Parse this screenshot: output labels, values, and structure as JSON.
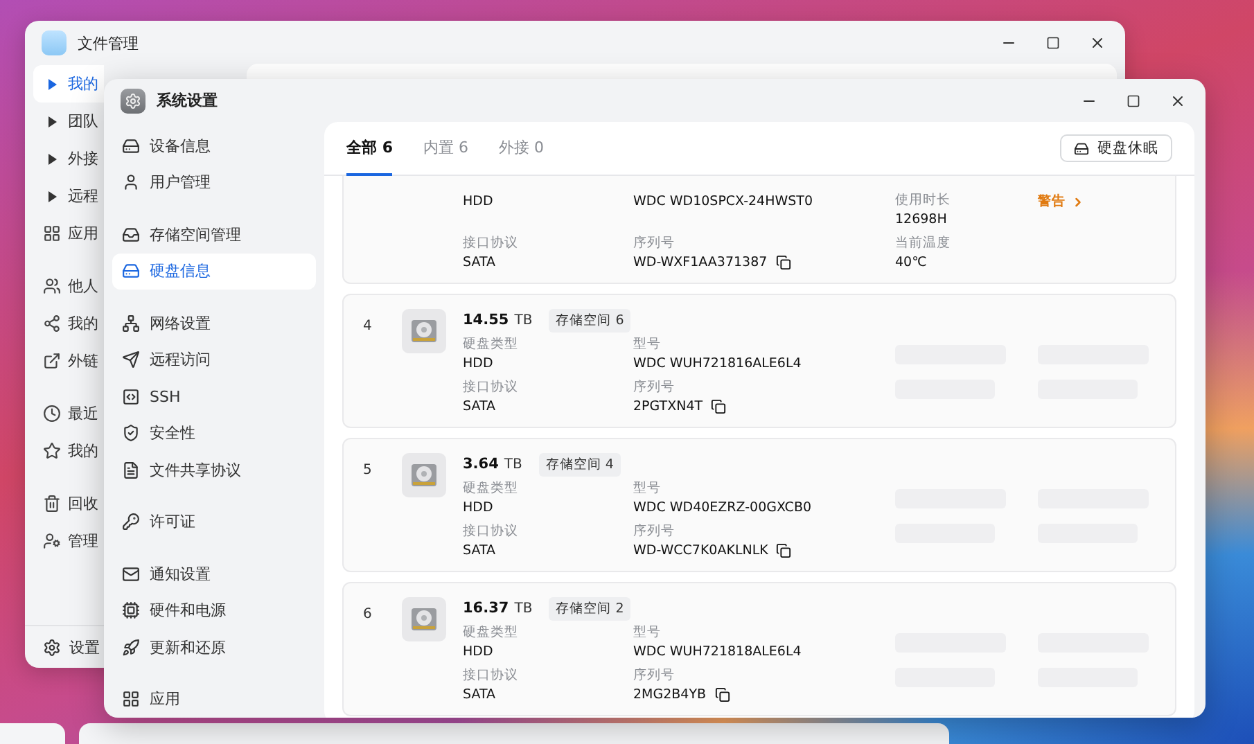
{
  "back_window": {
    "title": "文件管理",
    "sidebar": [
      [
        {
          "label": "我的",
          "kind": "folder",
          "selected": true
        },
        {
          "label": "团队",
          "kind": "folder",
          "selected": false
        },
        {
          "label": "外接",
          "kind": "folder",
          "selected": false
        },
        {
          "label": "远程",
          "kind": "folder",
          "selected": false
        },
        {
          "label": "应用",
          "kind": "item",
          "selected": false
        }
      ],
      [
        {
          "label": "他人",
          "kind": "item",
          "selected": false
        },
        {
          "label": "我的",
          "kind": "item",
          "selected": false
        },
        {
          "label": "外链",
          "kind": "item",
          "selected": false
        }
      ],
      [
        {
          "label": "最近",
          "kind": "item",
          "selected": false
        },
        {
          "label": "我的",
          "kind": "item",
          "selected": false
        }
      ],
      [
        {
          "label": "回收",
          "kind": "item",
          "selected": false
        },
        {
          "label": "管理",
          "kind": "item",
          "selected": false
        }
      ]
    ],
    "footer": "设置"
  },
  "settings_window": {
    "title": "系统设置",
    "nav": [
      [
        {
          "label": "设备信息",
          "selected": false
        },
        {
          "label": "用户管理",
          "selected": false
        }
      ],
      [
        {
          "label": "存储空间管理",
          "selected": false
        },
        {
          "label": "硬盘信息",
          "selected": true
        }
      ],
      [
        {
          "label": "网络设置",
          "selected": false
        },
        {
          "label": "远程访问",
          "selected": false
        },
        {
          "label": "SSH",
          "selected": false
        },
        {
          "label": "安全性",
          "selected": false
        },
        {
          "label": "文件共享协议",
          "selected": false
        }
      ],
      [
        {
          "label": "许可证",
          "selected": false
        }
      ],
      [
        {
          "label": "通知设置",
          "selected": false
        },
        {
          "label": "硬件和电源",
          "selected": false
        },
        {
          "label": "更新和还原",
          "selected": false
        }
      ],
      [
        {
          "label": "应用",
          "selected": false
        }
      ]
    ],
    "tabs": [
      {
        "label": "全部 6",
        "selected": true
      },
      {
        "label": "内置 6",
        "selected": false
      },
      {
        "label": "外接 0",
        "selected": false
      }
    ],
    "sleep_button": "硬盘休眠",
    "disks": [
      {
        "fields": [
          {
            "kind": "text",
            "value": "HDD"
          },
          {
            "kind": "text",
            "label": "接口协议",
            "value": "SATA"
          },
          {
            "kind": "text",
            "value": "WDC WD10SPCX-24HWST0"
          },
          {
            "kind": "copy",
            "label": "序列号",
            "value": "WD-WXF1AA371387"
          },
          {
            "kind": "text",
            "label": "使用时长",
            "value": "12698H"
          },
          {
            "kind": "text",
            "label": "当前温度",
            "value": "40℃"
          },
          {
            "kind": "status",
            "value": "警告"
          }
        ]
      },
      {
        "number": "4",
        "capacity": "14.55",
        "unit": "TB",
        "pool": "存储空间 6",
        "fields": [
          {
            "kind": "text",
            "label": "硬盘类型",
            "value": "HDD"
          },
          {
            "kind": "text",
            "label": "接口协议",
            "value": "SATA"
          },
          {
            "kind": "text",
            "label": "型号",
            "value": "WDC WUH721816ALE6L4"
          },
          {
            "kind": "copy",
            "label": "序列号",
            "value": "2PGTXN4T"
          },
          {
            "kind": "skeleton"
          },
          {
            "kind": "skeleton"
          },
          {
            "kind": "skeleton"
          },
          {
            "kind": "skeleton"
          }
        ]
      },
      {
        "number": "5",
        "capacity": "3.64",
        "unit": "TB",
        "pool": "存储空间 4",
        "fields": [
          {
            "kind": "text",
            "label": "硬盘类型",
            "value": "HDD"
          },
          {
            "kind": "text",
            "label": "接口协议",
            "value": "SATA"
          },
          {
            "kind": "text",
            "label": "型号",
            "value": "WDC WD40EZRZ-00GXCB0"
          },
          {
            "kind": "copy",
            "label": "序列号",
            "value": "WD-WCC7K0AKLNLK"
          },
          {
            "kind": "skeleton"
          },
          {
            "kind": "skeleton"
          },
          {
            "kind": "skeleton"
          },
          {
            "kind": "skeleton"
          }
        ]
      },
      {
        "number": "6",
        "capacity": "16.37",
        "unit": "TB",
        "pool": "存储空间 2",
        "fields": [
          {
            "kind": "text",
            "label": "硬盘类型",
            "value": "HDD"
          },
          {
            "kind": "text",
            "label": "接口协议",
            "value": "SATA"
          },
          {
            "kind": "text",
            "label": "型号",
            "value": "WDC WUH721818ALE6L4"
          },
          {
            "kind": "copy",
            "label": "序列号",
            "value": "2MG2B4YB"
          },
          {
            "kind": "skeleton"
          },
          {
            "kind": "skeleton"
          },
          {
            "kind": "skeleton"
          },
          {
            "kind": "skeleton"
          }
        ]
      }
    ]
  }
}
